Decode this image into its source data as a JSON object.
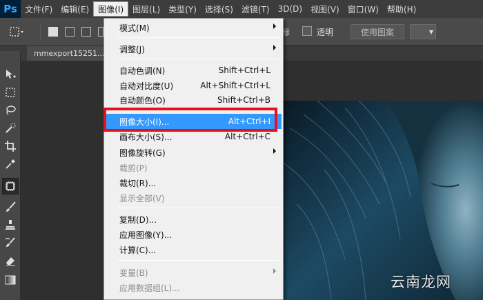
{
  "app": {
    "logo_text": "Ps"
  },
  "menubar": {
    "items": [
      {
        "label": "文件(F)"
      },
      {
        "label": "编辑(E)"
      },
      {
        "label": "图像(I)"
      },
      {
        "label": "图层(L)"
      },
      {
        "label": "类型(Y)"
      },
      {
        "label": "选择(S)"
      },
      {
        "label": "滤镜(T)"
      },
      {
        "label": "3D(D)"
      },
      {
        "label": "视图(V)"
      },
      {
        "label": "窗口(W)"
      },
      {
        "label": "帮助(H)"
      }
    ],
    "active_index": 2
  },
  "options_bar": {
    "label_tail": "标",
    "transparent_label": "透明",
    "transparent_checked": false,
    "use_pattern_button": "使用图案"
  },
  "document": {
    "tab_title": "mmexport15251..."
  },
  "image_menu": {
    "items": [
      {
        "label": "模式(M)",
        "shortcut": "",
        "submenu": true,
        "disabled": false
      },
      {
        "label": "调整(J)",
        "shortcut": "",
        "submenu": true,
        "disabled": false
      },
      {
        "label": "自动色调(N)",
        "shortcut": "Shift+Ctrl+L",
        "submenu": false,
        "disabled": false
      },
      {
        "label": "自动对比度(U)",
        "shortcut": "Alt+Shift+Ctrl+L",
        "submenu": false,
        "disabled": false
      },
      {
        "label": "自动颜色(O)",
        "shortcut": "Shift+Ctrl+B",
        "submenu": false,
        "disabled": false
      },
      {
        "label": "图像大小(I)...",
        "shortcut": "Alt+Ctrl+I",
        "submenu": false,
        "disabled": false,
        "highlighted": true
      },
      {
        "label": "画布大小(S)...",
        "shortcut": "Alt+Ctrl+C",
        "submenu": false,
        "disabled": false
      },
      {
        "label": "图像旋转(G)",
        "shortcut": "",
        "submenu": true,
        "disabled": false
      },
      {
        "label": "裁剪(P)",
        "shortcut": "",
        "submenu": false,
        "disabled": true
      },
      {
        "label": "裁切(R)...",
        "shortcut": "",
        "submenu": false,
        "disabled": false
      },
      {
        "label": "显示全部(V)",
        "shortcut": "",
        "submenu": false,
        "disabled": true
      },
      {
        "label": "复制(D)...",
        "shortcut": "",
        "submenu": false,
        "disabled": false
      },
      {
        "label": "应用图像(Y)...",
        "shortcut": "",
        "submenu": false,
        "disabled": false
      },
      {
        "label": "计算(C)...",
        "shortcut": "",
        "submenu": false,
        "disabled": false
      },
      {
        "label": "变量(B)",
        "shortcut": "",
        "submenu": true,
        "disabled": true
      },
      {
        "label": "应用数据组(L)...",
        "shortcut": "",
        "submenu": false,
        "disabled": true
      }
    ]
  },
  "watermark": {
    "text": "云南龙网"
  },
  "colors": {
    "highlight": "#3399ff",
    "annotation_box": "#e8101a",
    "menubar_bg": "#3c3c3c",
    "menu_bg": "#f0f0f0"
  },
  "icons": {
    "tools": [
      "move-icon",
      "marquee-icon",
      "lasso-icon",
      "quick-select-icon",
      "crop-icon",
      "eyedropper-icon",
      "healing-brush-icon",
      "brush-icon",
      "clone-stamp-icon",
      "history-brush-icon",
      "eraser-icon",
      "gradient-icon"
    ]
  }
}
